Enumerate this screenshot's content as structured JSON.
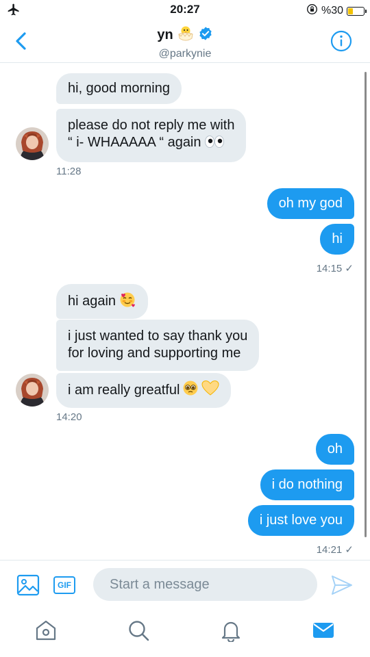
{
  "status_bar": {
    "time": "20:27",
    "battery_label": "%30",
    "battery_level": 0.3,
    "icons": [
      "airplane-icon",
      "orientation-lock-icon",
      "battery-icon"
    ]
  },
  "header": {
    "name": "yn",
    "handle": "@parkynie",
    "name_emoji": "hatching-chick",
    "icons": [
      "back-chevron-icon",
      "verified-badge-icon",
      "info-icon"
    ]
  },
  "conversation": {
    "groups": [
      {
        "sender": "them",
        "messages": [
          {
            "text": "hi, good morning"
          },
          {
            "line1": "please do not reply me with",
            "line2": "“ i- WHAAAAA “ again",
            "emoji": "eyes"
          }
        ],
        "timestamp": "11:28"
      },
      {
        "sender": "me",
        "messages": [
          {
            "text": "oh my god"
          },
          {
            "text": "hi"
          }
        ],
        "timestamp": "14:15 ✓"
      },
      {
        "sender": "them",
        "messages": [
          {
            "text": "hi again",
            "emoji": "smiling-face-with-hearts"
          },
          {
            "line1": "i just wanted to say thank you",
            "line2": "for loving and supporting me"
          },
          {
            "text": "i am really greatful",
            "emoji": [
              "pleading-face",
              "yellow-heart"
            ]
          }
        ],
        "timestamp": "14:20"
      },
      {
        "sender": "me",
        "messages": [
          {
            "text": "oh"
          },
          {
            "text": "i do nothing"
          },
          {
            "text": "i just love you"
          }
        ],
        "timestamp": "14:21 ✓"
      }
    ]
  },
  "composer": {
    "gif_label": "GIF",
    "placeholder": "Start a message",
    "icons": [
      "image-icon",
      "gif-icon",
      "send-icon"
    ]
  },
  "tab_bar": {
    "tabs": [
      "home-icon",
      "search-icon",
      "notifications-icon",
      "messages-icon"
    ],
    "active": "messages-icon"
  },
  "colors": {
    "accent": "#1d9bf0",
    "incoming_bubble": "#e6ecf0",
    "muted_text": "#657786",
    "battery": "#f2c200"
  }
}
